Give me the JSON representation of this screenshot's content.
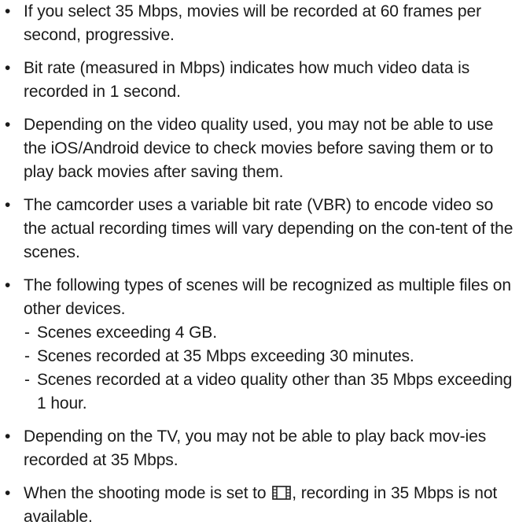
{
  "bullet_glyph": "•",
  "dash_glyph": "-",
  "notes": [
    {
      "text": "If you select 35 Mbps, movies will be recorded at 60 frames per second, progressive."
    },
    {
      "text": "Bit rate (measured in Mbps) indicates how much video data is recorded in 1 second."
    },
    {
      "text": "Depending on the video quality used, you may not be able to use the iOS/Android device to check movies before saving them or to play back movies after saving them."
    },
    {
      "text": "The camcorder uses a variable bit rate (VBR) to encode video so the actual recording times will vary depending on the con-tent of the scenes."
    },
    {
      "text": "The following types of scenes will be recognized as multiple files on other devices.",
      "sub_items": [
        "Scenes exceeding 4 GB.",
        "Scenes recorded at 35 Mbps exceeding 30 minutes.",
        "Scenes recorded at a video quality other than 35 Mbps exceeding 1 hour."
      ]
    },
    {
      "text": "Depending on the TV, you may not be able to play back mov-ies recorded at 35 Mbps."
    },
    {
      "text_before_icon": "When the shooting mode is set to",
      "icon": "movie-mode-icon",
      "text_after_icon": ", recording in 35 Mbps is not available."
    }
  ]
}
